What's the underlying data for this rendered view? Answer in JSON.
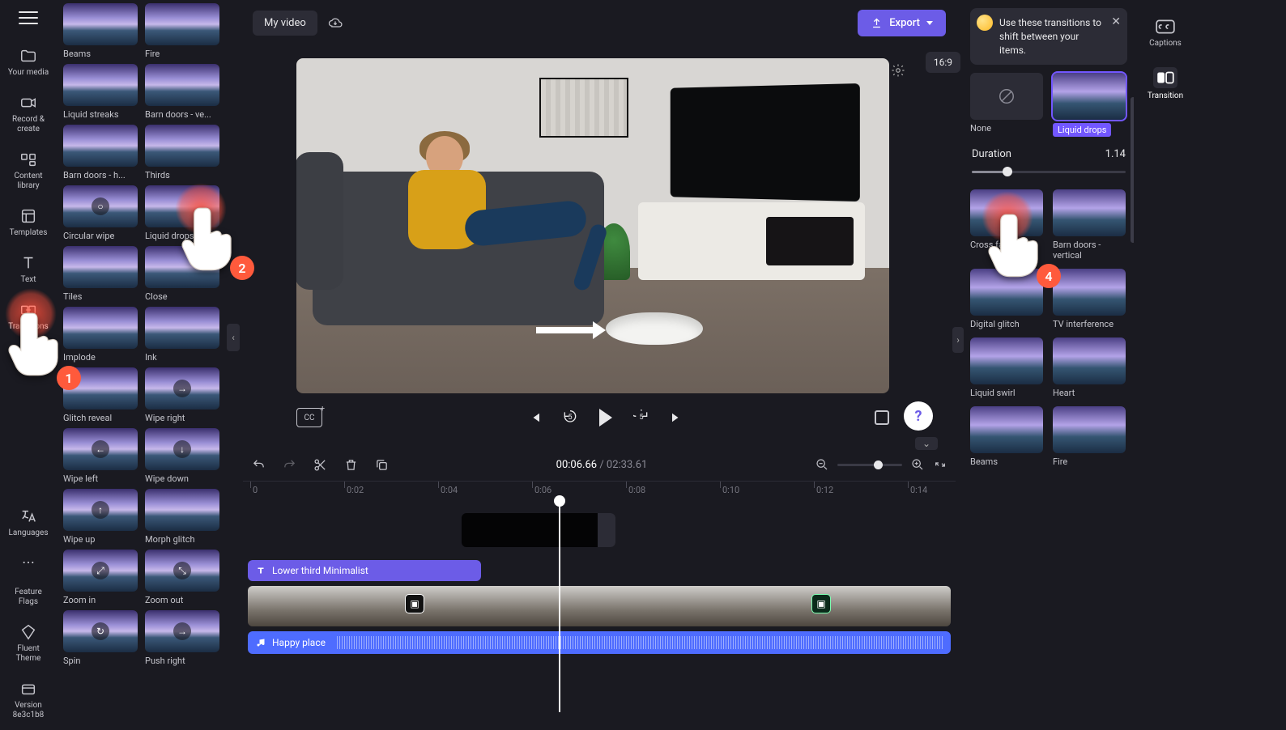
{
  "project": {
    "name": "My video",
    "aspect_ratio": "16:9"
  },
  "export_label": "Export",
  "left_rail": [
    {
      "key": "your-media",
      "label": "Your media"
    },
    {
      "key": "record-create",
      "label": "Record & create"
    },
    {
      "key": "content-library",
      "label": "Content library"
    },
    {
      "key": "templates",
      "label": "Templates"
    },
    {
      "key": "text",
      "label": "Text"
    },
    {
      "key": "transitions",
      "label": "Transitions"
    }
  ],
  "left_rail_bottom": [
    {
      "key": "languages",
      "label": "Languages"
    },
    {
      "key": "more",
      "label": "..."
    },
    {
      "key": "feature-flags",
      "label": "Feature Flags"
    },
    {
      "key": "fluent-theme",
      "label": "Fluent Theme"
    },
    {
      "key": "version",
      "label": "Version 8e3c1b8"
    }
  ],
  "library": [
    {
      "label": "Beams",
      "icon": ""
    },
    {
      "label": "Fire",
      "icon": ""
    },
    {
      "label": "Liquid streaks",
      "icon": ""
    },
    {
      "label": "Barn doors - ve...",
      "icon": ""
    },
    {
      "label": "Barn doors - h...",
      "icon": ""
    },
    {
      "label": "Thirds",
      "icon": ""
    },
    {
      "label": "Circular wipe",
      "icon": "○"
    },
    {
      "label": "Liquid drops",
      "icon": ""
    },
    {
      "label": "Tiles",
      "icon": ""
    },
    {
      "label": "Close",
      "icon": ""
    },
    {
      "label": "Implode",
      "icon": ""
    },
    {
      "label": "Ink",
      "icon": ""
    },
    {
      "label": "Glitch reveal",
      "icon": ""
    },
    {
      "label": "Wipe right",
      "icon": "→"
    },
    {
      "label": "Wipe left",
      "icon": "←"
    },
    {
      "label": "Wipe down",
      "icon": "↓"
    },
    {
      "label": "Wipe up",
      "icon": "↑"
    },
    {
      "label": "Morph glitch",
      "icon": ""
    },
    {
      "label": "Zoom in",
      "icon": "⤢"
    },
    {
      "label": "Zoom out",
      "icon": "⤡"
    },
    {
      "label": "Spin",
      "icon": "↻"
    },
    {
      "label": "Push right",
      "icon": "→"
    }
  ],
  "playback": {
    "current": "00:06.66",
    "total": "02:33.61",
    "ruler": [
      "0",
      "0:02",
      "0:04",
      "0:06",
      "0:08",
      "0:10",
      "0:12",
      "0:14"
    ]
  },
  "timeline": {
    "title_clip": "Lower third Minimalist",
    "audio_clip": "Happy place"
  },
  "tip": {
    "text": "Use these transitions to shift between your items.",
    "emoji": "🤩"
  },
  "panel": {
    "duration_label": "Duration",
    "duration_value": "1.14",
    "none_label": "None",
    "selected_label": "Liquid drops",
    "items": [
      {
        "label": "Cross fade"
      },
      {
        "label": "Barn doors - vertical"
      },
      {
        "label": "Digital glitch"
      },
      {
        "label": "TV interference"
      },
      {
        "label": "Liquid swirl"
      },
      {
        "label": "Heart"
      },
      {
        "label": "Beams"
      },
      {
        "label": "Fire"
      }
    ]
  },
  "right_rail": [
    {
      "key": "captions",
      "label": "Captions"
    },
    {
      "key": "transition",
      "label": "Transition"
    }
  ],
  "annotations": {
    "n1": "1",
    "n2": "2",
    "n4": "4"
  }
}
